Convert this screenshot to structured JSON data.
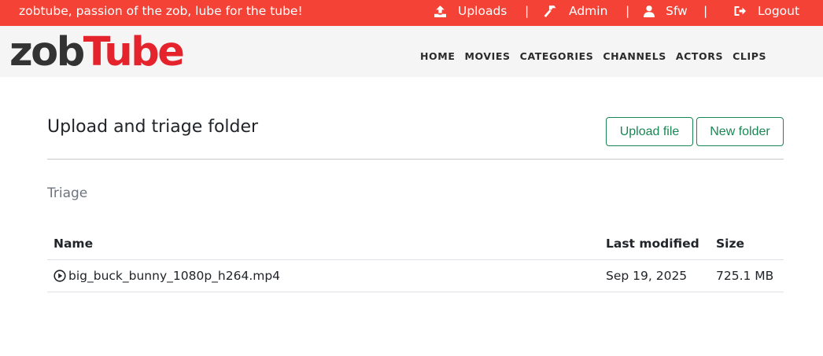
{
  "topbar": {
    "tagline": "zobtube, passion of the zob, lube for the tube!",
    "items": [
      {
        "label": "Uploads",
        "icon": "upload-icon"
      },
      {
        "label": "Admin",
        "icon": "hammer-icon"
      },
      {
        "label": "Sfw",
        "icon": "user-icon"
      },
      {
        "label": "Logout",
        "icon": "sign-out-icon"
      }
    ],
    "separator": "|"
  },
  "logo": {
    "part1": "zob",
    "part2": "Tube"
  },
  "nav": {
    "home": "HOME",
    "movies": "MOVIES",
    "categories": "CATEGORIES",
    "channels": "CHANNELS",
    "actors": "ACTORS",
    "clips": "CLIPS"
  },
  "main": {
    "title": "Upload and triage folder",
    "upload_file_label": "Upload file",
    "new_folder_label": "New folder",
    "folder": "Triage"
  },
  "table": {
    "headers": {
      "name": "Name",
      "modified": "Last modified",
      "size": "Size"
    },
    "rows": [
      {
        "name": "big_buck_bunny_1080p_h264.mp4",
        "modified": "Sep 19, 2025",
        "size": "725.1 MB",
        "icon": "play-circle-icon"
      }
    ]
  },
  "colors": {
    "topbar": "#f44336",
    "logo_dark": "#333333",
    "logo_red": "#e4232d",
    "button_green": "#198754"
  }
}
